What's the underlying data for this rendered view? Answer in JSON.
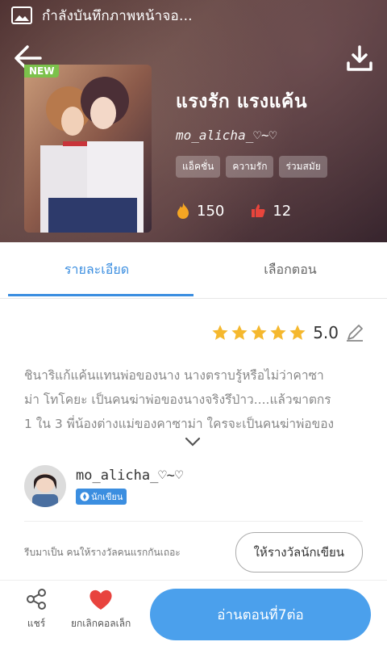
{
  "status_bar": {
    "text": "กำลังบันทึกภาพหน้าจอ...",
    "icon": "image-icon"
  },
  "header": {
    "back_icon": "back-arrow-icon",
    "download_icon": "download-icon",
    "badge": "NEW",
    "title": "แรงรัก แรงแค้น",
    "author": "mo_alicha_♡~♡",
    "tags": [
      "แอ็คชั่น",
      "ความรัก",
      "ร่วมสมัย"
    ],
    "views": "150",
    "likes": "12"
  },
  "tabs": [
    {
      "label": "รายละเอียด",
      "active": true
    },
    {
      "label": "เลือกตอน",
      "active": false
    }
  ],
  "rating": {
    "stars": 5,
    "score": "5.0",
    "star_color": "#f5b82e"
  },
  "synopsis": [
    "ชินาริแก้แค้นแทนพ่อของนาง นางตราบรู้หรือไม่ว่าคาซา",
    "ม่า โทโคยะ เป็นคนฆ่าพ่อของนางจริงรึป่าว....แล้วฆาตกร",
    "1 ใน 3 พี่น้องต่างแม่ของคาซาม่า ใครจะเป็นคนฆ่าพ่อของ"
  ],
  "author_card": {
    "name": "mo_alicha_♡~♡",
    "badge": "นักเขียน"
  },
  "reward": {
    "hint": "รีบมาเป็น คนให้รางวัลคนแรกกันเถอะ",
    "button": "ให้รางวัลนักเขียน"
  },
  "bottom": {
    "share": "แชร์",
    "favorite": "ยกเลิกคอลเล็ก",
    "read": "อ่านตอนที่7ต่อ",
    "accent": "#4ba0ec"
  }
}
